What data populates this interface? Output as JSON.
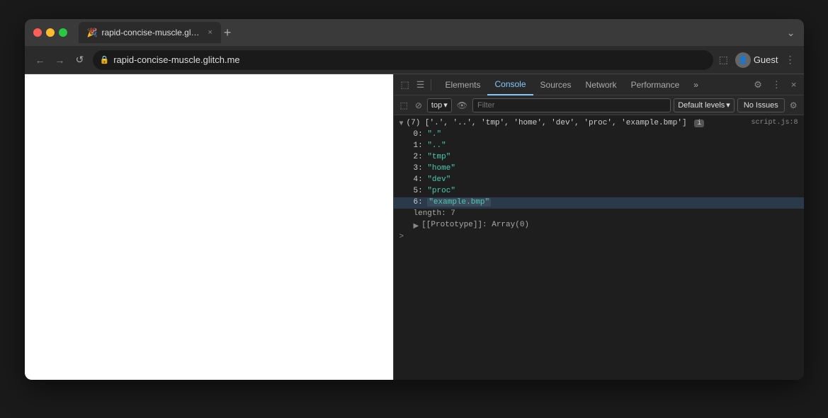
{
  "browser": {
    "traffic_lights": [
      "close",
      "minimize",
      "maximize"
    ],
    "tab": {
      "favicon": "🎉",
      "title": "rapid-concise-muscle.glitch.m...",
      "close": "×"
    },
    "new_tab_label": "+",
    "expand_btn": "⌄",
    "nav": {
      "back": "←",
      "forward": "→",
      "refresh": "↺"
    },
    "address": {
      "lock_icon": "🔒",
      "url": "rapid-concise-muscle.glitch.me"
    },
    "right_icons": {
      "cast": "⬚",
      "profile_icon": "👤",
      "profile_label": "Guest",
      "more": "⋮"
    }
  },
  "devtools": {
    "toolbar_icons": {
      "dock": "⬚",
      "mobile": "⬜",
      "cursor": "⬚",
      "separator": true,
      "settings": "⚙",
      "more": "⋮",
      "close": "×"
    },
    "tabs": [
      {
        "label": "Elements",
        "active": false
      },
      {
        "label": "Console",
        "active": true
      },
      {
        "label": "Sources",
        "active": false
      },
      {
        "label": "Network",
        "active": false
      },
      {
        "label": "Performance",
        "active": false
      },
      {
        "label": "»",
        "active": false
      }
    ],
    "console_bar": {
      "sidebar_icon": "⬚",
      "clear_icon": "⊘",
      "top_label": "top",
      "dropdown_arrow": "▾",
      "eye_icon": "👁",
      "filter_placeholder": "Filter",
      "default_levels_label": "Default levels",
      "default_levels_arrow": "▾",
      "no_issues_label": "No Issues",
      "settings_icon": "⚙"
    },
    "console_output": {
      "array_line": {
        "arrow": "▼",
        "summary": "(7) ['.', '..', 'tmp', 'home', 'dev', 'proc', 'example.bmp']",
        "badge": "i",
        "script_link": "script.js:8"
      },
      "items": [
        {
          "index": "0:",
          "value": "\".\"",
          "highlighted": false
        },
        {
          "index": "1:",
          "value": "\"..\"",
          "highlighted": false
        },
        {
          "index": "2:",
          "value": "\"tmp\"",
          "highlighted": false
        },
        {
          "index": "3:",
          "value": "\"home\"",
          "highlighted": false
        },
        {
          "index": "4:",
          "value": "\"dev\"",
          "highlighted": false
        },
        {
          "index": "5:",
          "value": "\"proc\"",
          "highlighted": false
        },
        {
          "index": "6:",
          "value": "\"example.bmp\"",
          "highlighted": true
        }
      ],
      "length_line": "length: 7",
      "prototype_line": "[[Prototype]]: Array(0)",
      "prototype_arrow": "▶"
    },
    "prompt_arrow": ">"
  }
}
